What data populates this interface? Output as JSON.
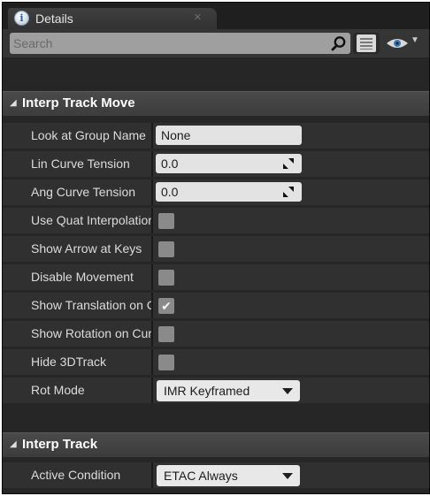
{
  "tab": {
    "title": "Details",
    "close_glyph": "×",
    "icon_glyph": "i"
  },
  "search": {
    "placeholder": "Search"
  },
  "toolbar": {
    "caret_glyph": "▼"
  },
  "sections": {
    "interp_track_move": {
      "title": "Interp Track Move",
      "arrow": "◢",
      "rows": [
        {
          "label": "Look at Group Name",
          "type": "text",
          "value": "None"
        },
        {
          "label": "Lin Curve Tension",
          "type": "number",
          "value": "0.0"
        },
        {
          "label": "Ang Curve Tension",
          "type": "number",
          "value": "0.0"
        },
        {
          "label": "Use Quat Interpolation",
          "type": "checkbox",
          "checked": false
        },
        {
          "label": "Show Arrow at Keys",
          "type": "checkbox",
          "checked": false
        },
        {
          "label": "Disable Movement",
          "type": "checkbox",
          "checked": false
        },
        {
          "label": "Show Translation on Curve Ed",
          "type": "checkbox",
          "checked": true,
          "checkmark": "✔"
        },
        {
          "label": "Show Rotation on Curve Ed",
          "type": "checkbox",
          "checked": false
        },
        {
          "label": "Hide 3DTrack",
          "type": "checkbox",
          "checked": false
        },
        {
          "label": "Rot Mode",
          "type": "combo",
          "value": "IMR Keyframed"
        }
      ]
    },
    "interp_track": {
      "title": "Interp Track",
      "arrow": "◢",
      "rows": [
        {
          "label": "Active Condition",
          "type": "combo",
          "value": "ETAC Always"
        }
      ]
    }
  },
  "colors": {
    "panel_background": "#262626",
    "row_background": "#303030",
    "header_background": "#444444",
    "field_background": "#e3e3e3",
    "label_text": "#dcdcdc"
  }
}
